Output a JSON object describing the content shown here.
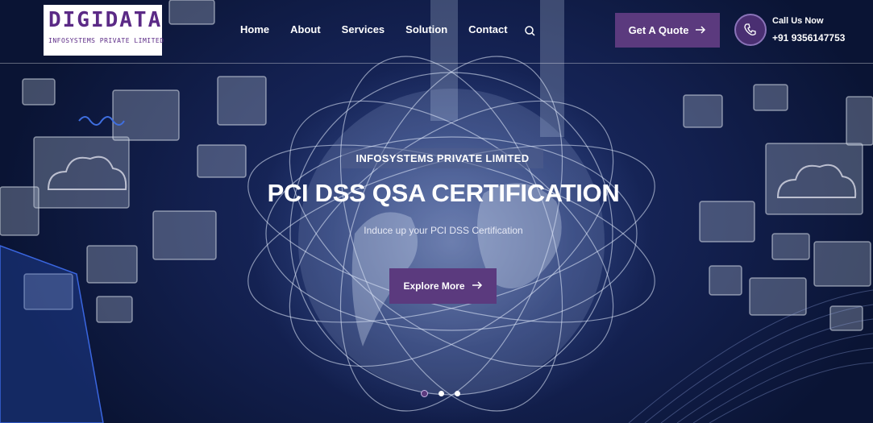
{
  "logo": {
    "main": "DIGIDATA",
    "sub": "INFOSYSTEMS PRIVATE LIMITED"
  },
  "nav": {
    "items": [
      {
        "label": "Home"
      },
      {
        "label": "About"
      },
      {
        "label": "Services"
      },
      {
        "label": "Solution"
      },
      {
        "label": "Contact"
      }
    ]
  },
  "header": {
    "quote_label": "Get A Quote",
    "call_label": "Call Us Now",
    "call_number": "+91 9356147753"
  },
  "hero": {
    "eyebrow": "INFOSYSTEMS PRIVATE LIMITED",
    "title": "PCI DSS QSA CERTIFICATION",
    "subtitle": "Induce up your PCI DSS Certification",
    "cta_label": "Explore More"
  },
  "slider": {
    "count": 3,
    "active": 1
  },
  "icons": [
    "search-icon",
    "arrow-right-icon",
    "phone-icon"
  ],
  "colors": {
    "accent": "#5b3a7e",
    "background": "#13204f",
    "text": "#ffffff"
  }
}
